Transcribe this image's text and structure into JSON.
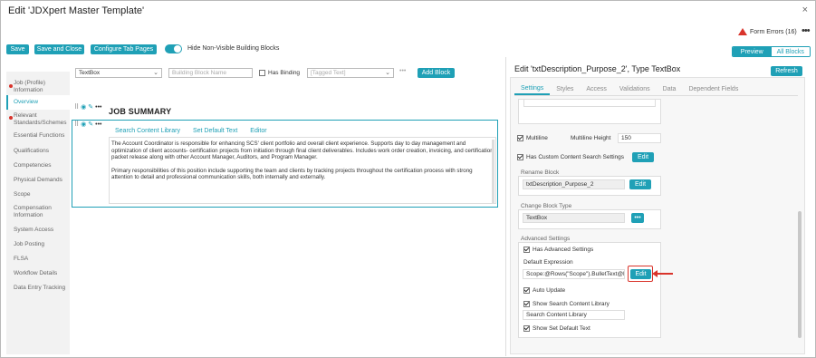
{
  "window": {
    "title": "Edit 'JDXpert Master Template'",
    "close": "×"
  },
  "header": {
    "form_errors": "Form Errors (16)",
    "more": "•••"
  },
  "toolbar": {
    "save": "Save",
    "save_close": "Save and Close",
    "configure_tabs": "Configure Tab Pages",
    "hide_nonvisible": "Hide Non-Visible Building Blocks",
    "hide_nonvisible_on": true,
    "view_preview": "Preview",
    "view_all_blocks": "All Blocks"
  },
  "sidebar": {
    "items": [
      {
        "label": "Job (Profile) Information",
        "error": true
      },
      {
        "label": "Overview",
        "active": true
      },
      {
        "label": "Relevant Standards/Schemes",
        "error": true
      },
      {
        "label": "Essential Functions"
      },
      {
        "label": "Qualifications"
      },
      {
        "label": "Competencies"
      },
      {
        "label": "Physical Demands"
      },
      {
        "label": "Scope"
      },
      {
        "label": "Compensation Information"
      },
      {
        "label": "System Access"
      },
      {
        "label": "Job Posting"
      },
      {
        "label": "FLSA"
      },
      {
        "label": "Workflow Details"
      },
      {
        "label": "Data Entry Tracking"
      }
    ]
  },
  "editor": {
    "block_type_select": "TextBox",
    "block_name_placeholder": "Building Block Name",
    "has_binding": "Has Binding",
    "tagged_text_placeholder": "[Tagged Text]",
    "add_block": "Add Block",
    "more": "•••",
    "heading": "JOB SUMMARY",
    "block_tabs": [
      "Search Content Library",
      "Set Default Text",
      "Editor"
    ],
    "paragraph1": "The Account Coordinator is responsible for enhancing SCS' client portfolio and overall client experience. Supports day to day management and optimization of client accounts- certification projects from initiation through final client deliverables.  Includes work order creation, invoicing, and certification packet release along with other Account Manager, Auditors, and Program Manager.",
    "paragraph2": "Primary responsibilities of this position include supporting the team and clients by tracking projects throughout the certification process with strong attention to detail and professional communication skills, both internally and externally."
  },
  "right_panel": {
    "title": "Edit 'txtDescription_Purpose_2', Type TextBox",
    "refresh": "Refresh",
    "tabs": [
      "Settings",
      "Styles",
      "Access",
      "Validations",
      "Data",
      "Dependent Fields"
    ],
    "multiline": "Multiline",
    "multiline_height_label": "Multiline Height",
    "multiline_height_value": "150",
    "custom_search": "Has Custom Content Search Settings",
    "edit": "Edit",
    "rename_block_label": "Rename Block",
    "rename_block_value": "txtDescription_Purpose_2",
    "change_block_type_label": "Change Block Type",
    "change_block_type_value": "TextBox",
    "advanced_settings_label": "Advanced Settings",
    "has_advanced_settings": "Has Advanced Settings",
    "default_expression_label": "Default Expression",
    "default_expression_value": "Scope:@Rows(\"Scope\").BulletText@M",
    "auto_update": "Auto Update",
    "show_search_library": "Show Search Content Library",
    "search_library_value": "Search Content Library",
    "show_default_text": "Show Set Default Text",
    "ellipsis": "•••"
  },
  "colors": {
    "accent": "#1fa0b6",
    "error": "#d9342b"
  }
}
